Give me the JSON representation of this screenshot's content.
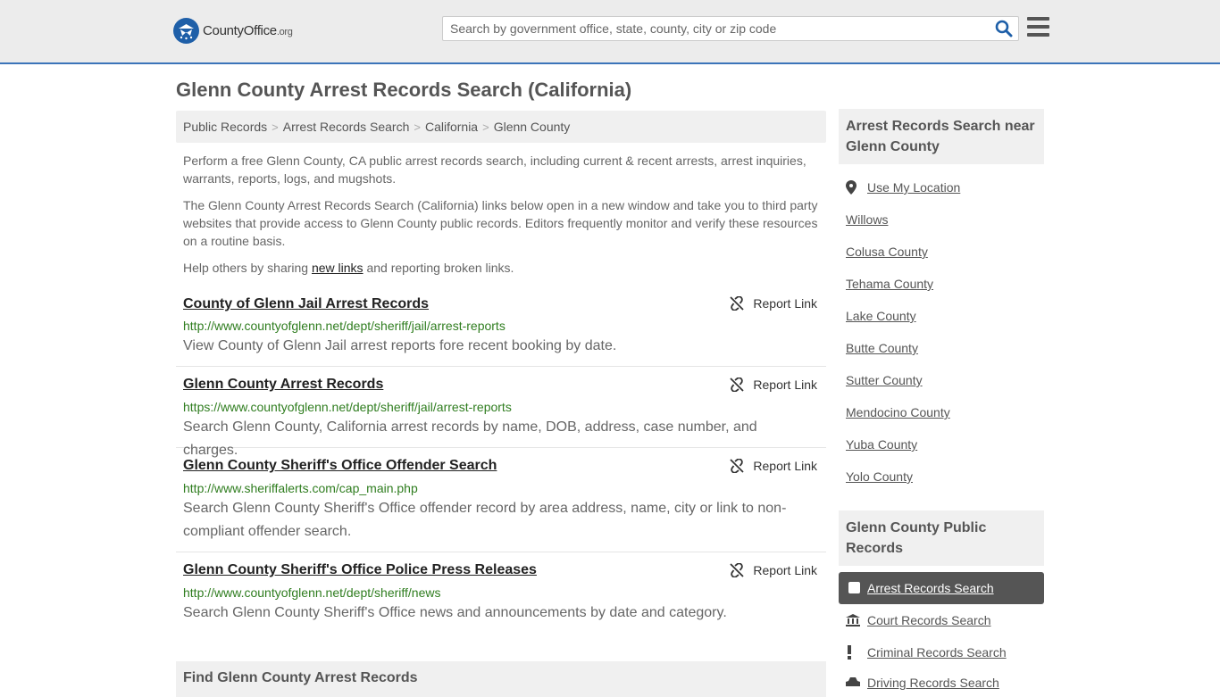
{
  "header": {
    "logo_main": "CountyOffice",
    "logo_tld": ".org",
    "search_placeholder": "Search by government office, state, county, city or zip code"
  },
  "page_title": "Glenn County Arrest Records Search (California)",
  "breadcrumb": [
    "Public Records",
    "Arrest Records Search",
    "California",
    "Glenn County"
  ],
  "intro": {
    "p1": "Perform a free Glenn County, CA public arrest records search, including current & recent arrests, arrest inquiries, warrants, reports, logs, and mugshots.",
    "p2": "The Glenn County Arrest Records Search (California) links below open in a new window and take you to third party websites that provide access to Glenn County public records. Editors frequently monitor and verify these resources on a routine basis.",
    "p3_before": "Help others by sharing ",
    "p3_link": "new links",
    "p3_after": " and reporting broken links."
  },
  "report_label": "Report Link",
  "records": [
    {
      "title": "County of Glenn Jail Arrest Records",
      "url": "http://www.countyofglenn.net/dept/sheriff/jail/arrest-reports",
      "desc": "View County of Glenn Jail arrest reports fore recent booking by date."
    },
    {
      "title": "Glenn County Arrest Records",
      "url": "https://www.countyofglenn.net/dept/sheriff/jail/arrest-reports",
      "desc": "Search Glenn County, California arrest records by name, DOB, address, case number, and charges."
    },
    {
      "title": "Glenn County Sheriff's Office Offender Search",
      "url": "http://www.sheriffalerts.com/cap_main.php",
      "desc": "Search Glenn County Sheriff's Office offender record by area address, name, city or link to non-compliant offender search."
    },
    {
      "title": "Glenn County Sheriff's Office Police Press Releases",
      "url": "http://www.countyofglenn.net/dept/sheriff/news",
      "desc": "Search Glenn County Sheriff's Office news and announcements by date and category."
    }
  ],
  "find_heading": "Find Glenn County Arrest Records",
  "sidebar": {
    "nearby_heading": "Arrest Records Search near Glenn County",
    "use_location": "Use My Location",
    "nearby": [
      "Willows",
      "Colusa County",
      "Tehama County",
      "Lake County",
      "Butte County",
      "Sutter County",
      "Mendocino County",
      "Yuba County",
      "Yolo County"
    ],
    "public_heading": "Glenn County Public Records",
    "public_active": "Arrest Records Search",
    "public_links": [
      "Court Records Search",
      "Criminal Records Search",
      "Driving Records Search"
    ]
  },
  "colors": {
    "accent": "#3b74b9",
    "url_green": "#2f7d1f",
    "active_bg": "#555555"
  }
}
